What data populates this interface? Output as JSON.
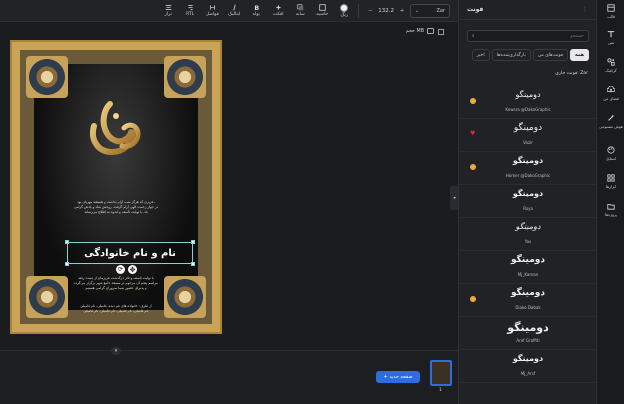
{
  "toolbar": {
    "font_select": "Zar",
    "font_size": "132.2",
    "minus": "−",
    "plus": "+",
    "items": [
      "رنگ",
      "حاشیه",
      "سایه",
      "افکت",
      "بولد",
      "ایتالیک",
      "فواصل",
      "RTL",
      "تراز"
    ]
  },
  "canvas": {
    "page_label": "حجم MB",
    "poster": {
      "lines_top": [
        "عزیزی که هرگز شب آرام نداشت و همیشه مهربان بود،",
        "در جوار رحمت الهی آرام گرفت. روحش شاد و یادش گرامی",
        "باد. با نهایت تأسف و اندوه به اطلاع می‌رساند"
      ],
      "title": "نام و نام خانوادگی",
      "lines_mid": [
        "با نهایت تاسف و تاثر درگذشت عزیزمان از دست رفته",
        "مراسم پنجم آن مرحوم در مسجد جامع شهر برگزار می‌گردد",
        "و پذیرای حضور شما سروران گرامی هستیم"
      ],
      "lines_bottom": [
        "از طرف: خانواده های غم دیده، فامیلی، نام فامیلی",
        "نام فامیلی، نام فامیلی، نام فامیلی، نام فامیلی"
      ]
    }
  },
  "bottom": {
    "collapse": "▾",
    "new_page": "صفحه جدید",
    "thumb_num": "1"
  },
  "panel": {
    "title": "فونت",
    "search_placeholder": "جستجو",
    "tabs": [
      "اخیر",
      "بارگذاری‌شده‌ها",
      "فونت‌های من",
      "همه"
    ],
    "current_font": "فونت جاری: Zar",
    "fonts": [
      {
        "sample": "دومینگو",
        "name": "Kewsra @DakoGraphic",
        "mark": "dot"
      },
      {
        "sample": "دومینگو",
        "name": "Vazir",
        "mark": "heart"
      },
      {
        "sample": "دومینگو",
        "name": "Homer @DakoGraphic",
        "mark": "dot"
      },
      {
        "sample": "دومینگو",
        "name": "Roya",
        "mark": ""
      },
      {
        "sample": "دومینگو",
        "name": "Yas",
        "mark": ""
      },
      {
        "sample": "دومینگو",
        "name": "Mj_Kaman",
        "mark": ""
      },
      {
        "sample": "دومینگو",
        "name": "Diako Dabak",
        "mark": "dot"
      },
      {
        "sample": "دومینگو",
        "name": "Aref Graffiti",
        "mark": ""
      },
      {
        "sample": "دومینگو",
        "name": "Mj_Arsf",
        "mark": ""
      }
    ]
  },
  "rail": [
    "قالب",
    "متن",
    "گرافیک",
    "فضای من",
    "هوش مصنوعی",
    "استایل",
    "ابزارها",
    "پروژه‌ها"
  ]
}
